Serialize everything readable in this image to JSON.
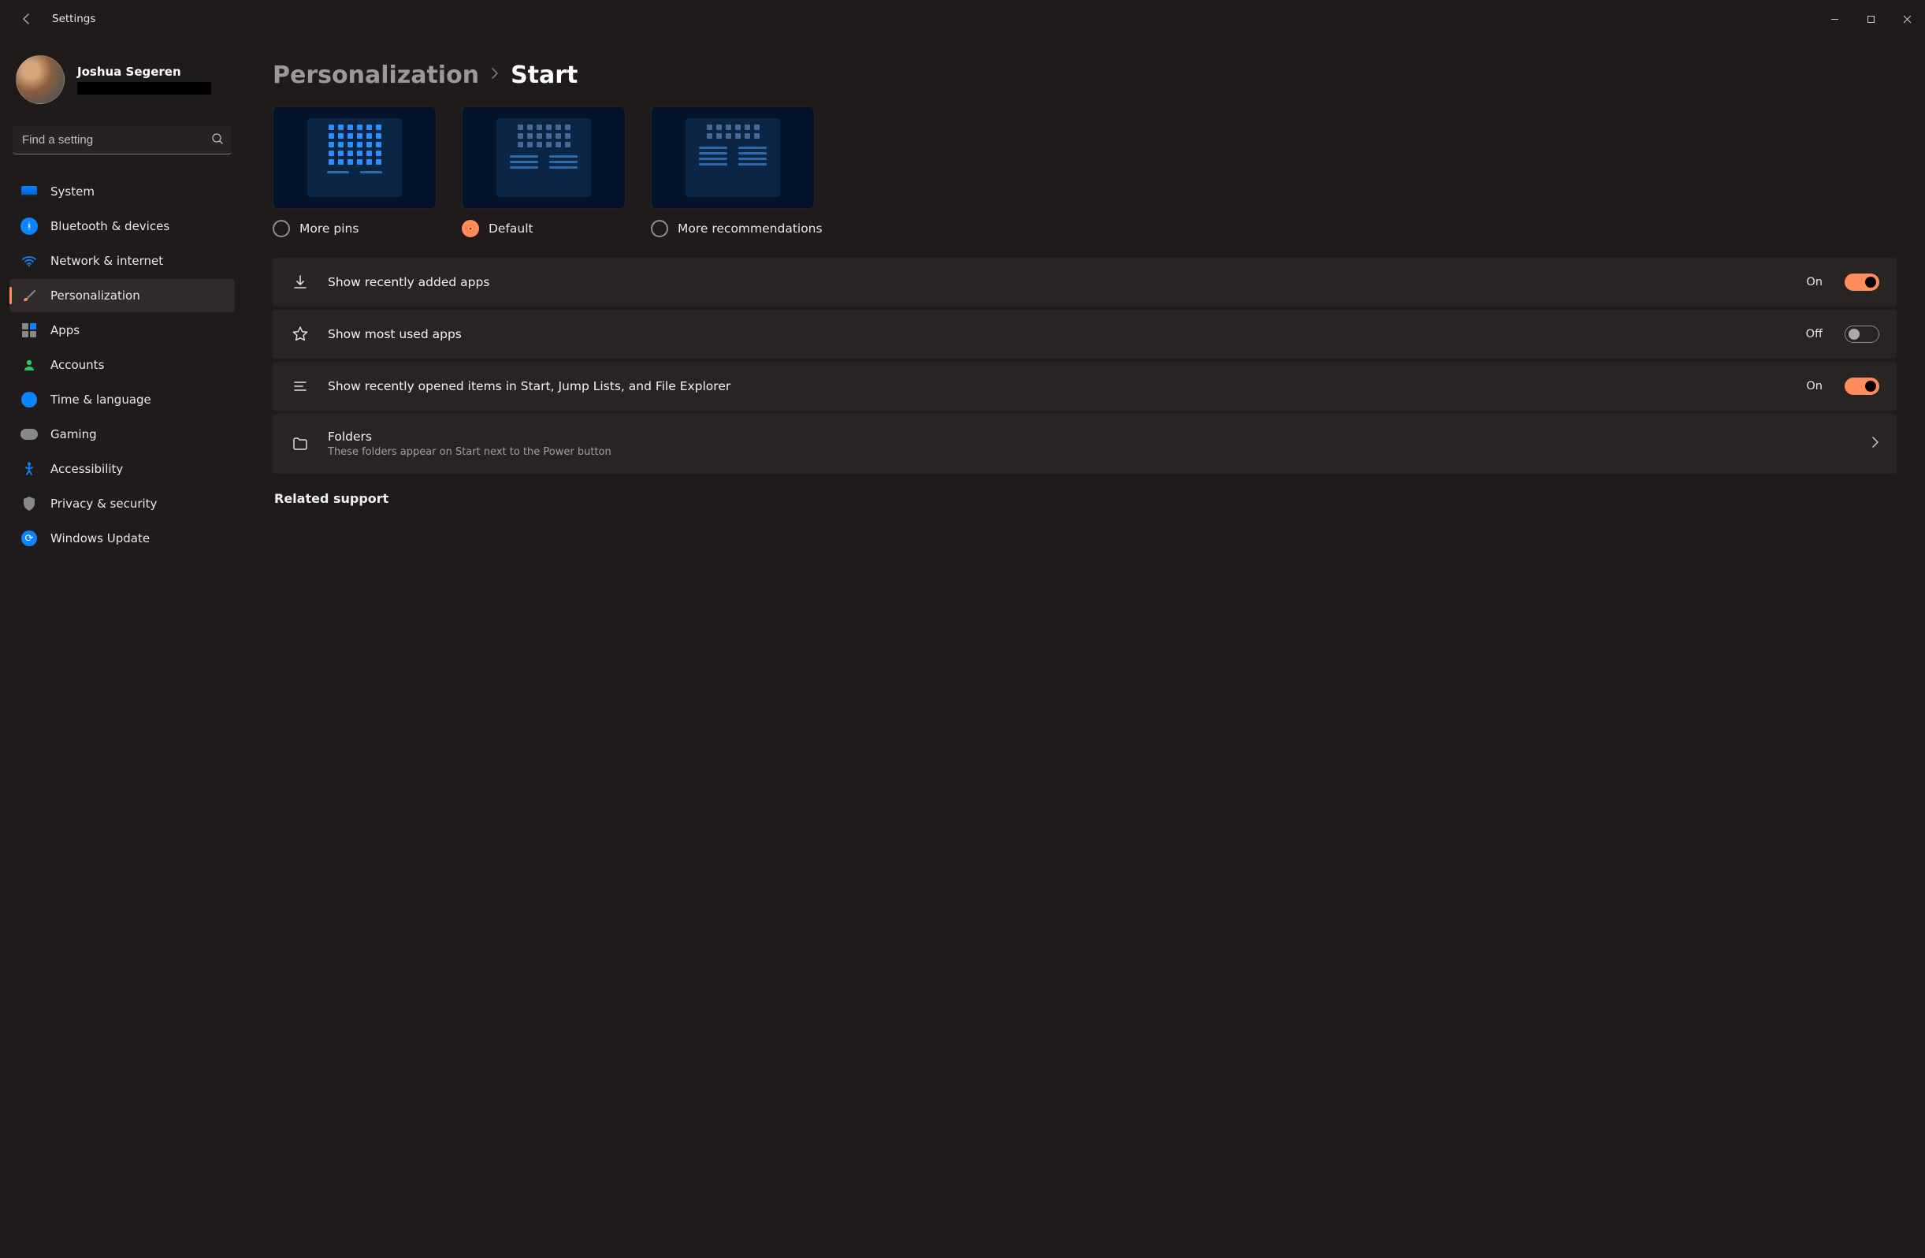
{
  "app_title": "Settings",
  "user": {
    "name": "Joshua Segeren"
  },
  "search": {
    "placeholder": "Find a setting"
  },
  "sidebar": {
    "items": [
      {
        "label": "System"
      },
      {
        "label": "Bluetooth & devices"
      },
      {
        "label": "Network & internet"
      },
      {
        "label": "Personalization"
      },
      {
        "label": "Apps"
      },
      {
        "label": "Accounts"
      },
      {
        "label": "Time & language"
      },
      {
        "label": "Gaming"
      },
      {
        "label": "Accessibility"
      },
      {
        "label": "Privacy & security"
      },
      {
        "label": "Windows Update"
      }
    ]
  },
  "breadcrumb": {
    "parent": "Personalization",
    "current": "Start"
  },
  "layout": {
    "options": [
      {
        "label": "More pins",
        "selected": false
      },
      {
        "label": "Default",
        "selected": true
      },
      {
        "label": "More recommendations",
        "selected": false
      }
    ]
  },
  "settings": {
    "recent_apps": {
      "label": "Show recently added apps",
      "state": "On",
      "on": true
    },
    "most_used": {
      "label": "Show most used apps",
      "state": "Off",
      "on": false
    },
    "recent_items": {
      "label": "Show recently opened items in Start, Jump Lists, and File Explorer",
      "state": "On",
      "on": true
    },
    "folders": {
      "label": "Folders",
      "sub": "These folders appear on Start next to the Power button"
    }
  },
  "related_support": "Related support"
}
